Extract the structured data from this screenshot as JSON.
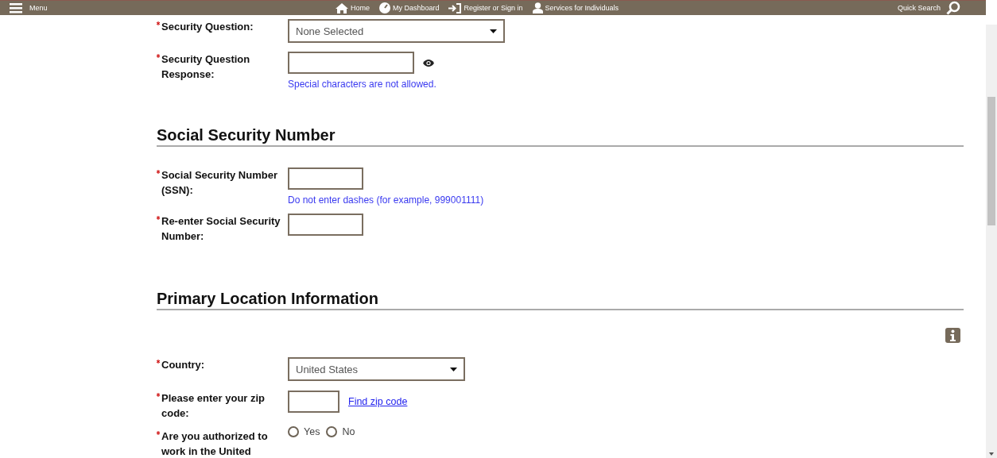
{
  "nav": {
    "menu": "Menu",
    "links": [
      {
        "label": "Home"
      },
      {
        "label": "My Dashboard"
      },
      {
        "label": "Register or Sign in"
      },
      {
        "label": "Services for Individuals"
      }
    ],
    "quick_search": "Quick Search"
  },
  "sections": [
    {
      "fields": [
        {
          "kind": "select",
          "label": "Security Question:",
          "required": true,
          "value": "None Selected"
        },
        {
          "kind": "input",
          "label": "Security Question Response:",
          "required": true,
          "reveal": true,
          "hint": "Special characters are not allowed."
        }
      ]
    },
    {
      "heading": "Social Security Number",
      "fields": [
        {
          "kind": "input",
          "label": "Social Security Number (SSN):",
          "required": true,
          "hint": "Do not enter dashes (for example, 999001111)"
        },
        {
          "kind": "input",
          "label": "Re-enter Social Security Number:",
          "required": true
        }
      ]
    },
    {
      "heading": "Primary Location Information",
      "info": true,
      "fields": [
        {
          "kind": "select",
          "label": "Country:",
          "required": true,
          "value": "United States"
        },
        {
          "kind": "input",
          "label": "Please enter your zip code:",
          "required": true,
          "link": "Find zip code"
        },
        {
          "kind": "radio",
          "label": "Are you authorized to work in the United",
          "required": true,
          "options": [
            {
              "label": "Yes",
              "selected": false
            },
            {
              "label": "No",
              "selected": false
            }
          ]
        }
      ]
    }
  ]
}
